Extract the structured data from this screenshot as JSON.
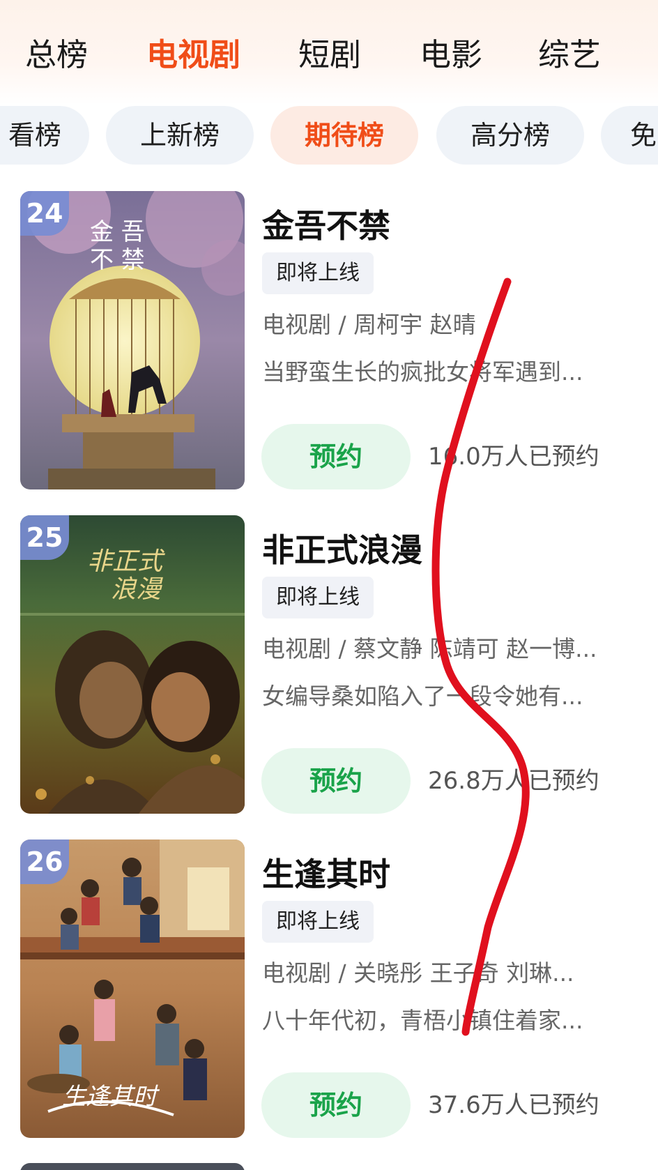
{
  "top_tabs": [
    {
      "label": "总榜",
      "active": false
    },
    {
      "label": "电视剧",
      "active": true
    },
    {
      "label": "短剧",
      "active": false
    },
    {
      "label": "电影",
      "active": false
    },
    {
      "label": "综艺",
      "active": false
    }
  ],
  "chips": [
    {
      "label": "看榜",
      "active": false
    },
    {
      "label": "上新榜",
      "active": false
    },
    {
      "label": "期待榜",
      "active": true
    },
    {
      "label": "高分榜",
      "active": false
    },
    {
      "label": "免",
      "active": false
    }
  ],
  "items": [
    {
      "rank": "24",
      "title": "金吾不禁",
      "status_tag": "即将上线",
      "meta": "电视剧 / 周柯宇 赵晴",
      "description": "当野蛮生长的疯批女将军遇到...",
      "reserve_label": "预约",
      "reservations": "16.0万人已预约",
      "poster_title": "金吾不禁"
    },
    {
      "rank": "25",
      "title": "非正式浪漫",
      "status_tag": "即将上线",
      "meta": "电视剧 / 蔡文静 陈靖可 赵一博...",
      "description": "女编导桑如陷入了一段令她有...",
      "reserve_label": "预约",
      "reservations": "26.8万人已预约",
      "poster_title": "非正式浪漫"
    },
    {
      "rank": "26",
      "title": "生逢其时",
      "status_tag": "即将上线",
      "meta": "电视剧 / 关晓彤 王子奇 刘琳...",
      "description": "八十年代初，青梧小镇住着家...",
      "reserve_label": "预约",
      "reservations": "37.6万人已预约",
      "poster_title": "生逢其时"
    }
  ],
  "colors": {
    "accent": "#f04d18",
    "reserve_green": "#1aa34a",
    "reserve_bg": "#e6f7ec",
    "rank_badge": "#788cd2",
    "annotation_red": "#e0101e"
  }
}
